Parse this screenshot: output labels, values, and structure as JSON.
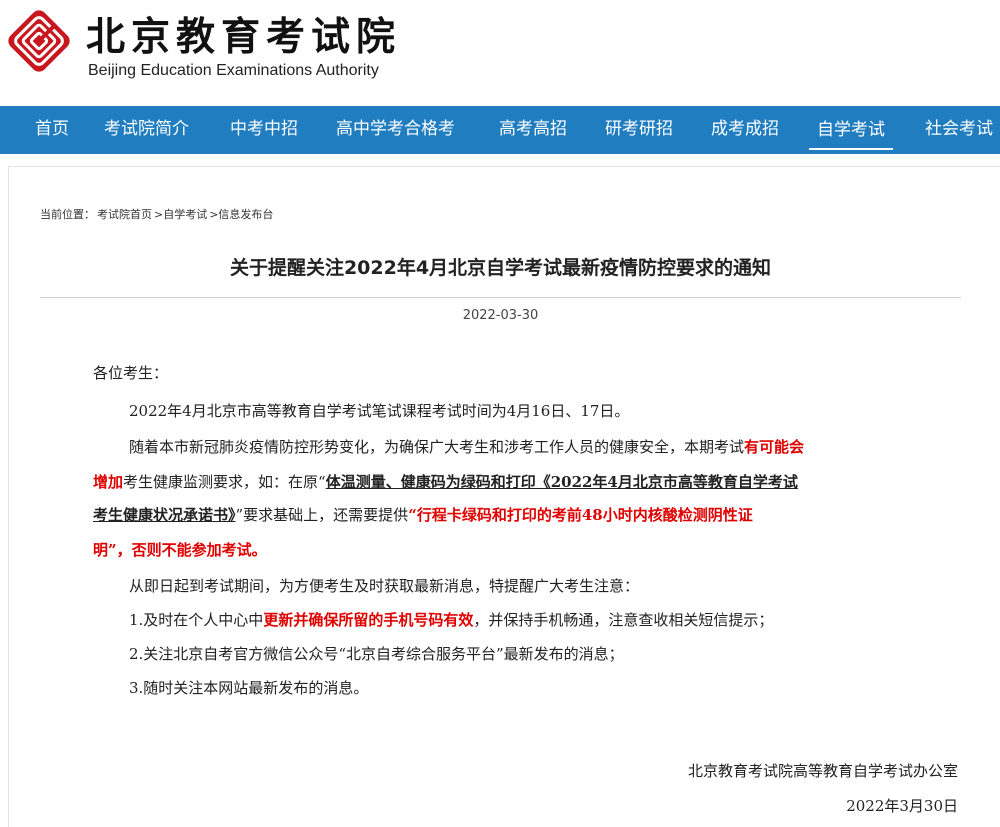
{
  "header": {
    "site_name": "北京教育考试院",
    "site_name_en": "Beijing Education Examinations Authority"
  },
  "nav": {
    "items": [
      "首页",
      "考试院简介",
      "中考中招",
      "高中学考合格考",
      "高考高招",
      "研考研招",
      "成考成招",
      "自学考试",
      "社会考试"
    ],
    "active_index": 7
  },
  "breadcrumb": {
    "prefix": "当前位置：",
    "items": [
      "考试院首页",
      ">自学考试",
      ">信息发布台"
    ]
  },
  "article": {
    "title": "关于提醒关注2022年4月北京自学考试最新疫情防控要求的通知",
    "date": "2022-03-30",
    "salutation": "各位考生：",
    "p1": "2022年4月北京市高等教育自学考试笔试课程考试时间为4月16日、17日。",
    "p2": {
      "a": "随着本市新冠肺炎疫情防控形势变化，为确保广大考生和涉考工作人员的健康安全，本期考试",
      "b": "有可能会",
      "c": "增加",
      "d": "考生健康监测要求，如：在原“",
      "e": "体温测量、健康码为绿码和打印《2022年4月北京市高等教育自学考试",
      "f": "考生健康状况承诺书》",
      "g": "”要求基础上，还需要提供",
      "h": "“行程卡绿码和打印的考前48小时内核酸检测阴性证",
      "i": "明”，否则不能参加考试。"
    },
    "p3": "从即日起到考试期间，为方便考生及时获取最新消息，特提醒广大考生注意：",
    "item1": {
      "a": "1.及时在个人中心中",
      "b": "更新并确保所留的手机号码有效",
      "c": "，并保持手机畅通，注意查收相关短信提示；"
    },
    "item2": "2.关注北京自考官方微信公众号“北京自考综合服务平台”最新发布的消息；",
    "item3": "3.随时关注本网站最新发布的消息。",
    "signature": "北京教育考试院高等教育自学考试办公室",
    "sign_date": "2022年3月30日"
  },
  "colors": {
    "nav_bg": "#1f7dc0",
    "logo_red": "#c8171e",
    "emphasis_red": "#e00000"
  }
}
